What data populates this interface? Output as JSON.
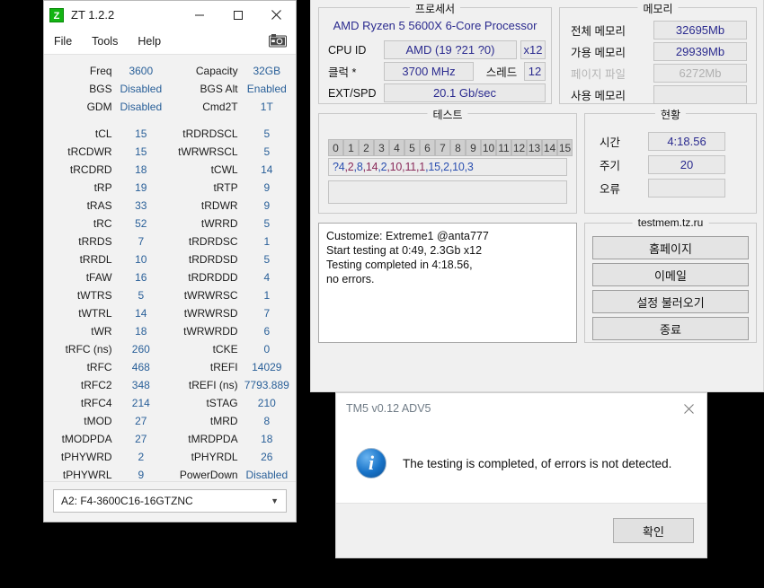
{
  "zt": {
    "title": "ZT 1.2.2",
    "logo_text": "Z",
    "menu": [
      "File",
      "Tools",
      "Help"
    ],
    "camera_icon": "camera-icon",
    "window_buttons": {
      "minimize": "minimize-icon",
      "maximize": "maximize-icon",
      "close": "close-icon"
    },
    "summary_rows": [
      {
        "l1": "Freq",
        "v1": "3600",
        "l2": "Capacity",
        "v2": "32GB"
      },
      {
        "l1": "BGS",
        "v1": "Disabled",
        "l2": "BGS Alt",
        "v2": "Enabled"
      },
      {
        "l1": "GDM",
        "v1": "Disabled",
        "l2": "Cmd2T",
        "v2": "1T"
      }
    ],
    "timing_rows": [
      {
        "l1": "tCL",
        "v1": "15",
        "l2": "tRDRDSCL",
        "v2": "5"
      },
      {
        "l1": "tRCDWR",
        "v1": "15",
        "l2": "tWRWRSCL",
        "v2": "5"
      },
      {
        "l1": "tRCDRD",
        "v1": "18",
        "l2": "tCWL",
        "v2": "14"
      },
      {
        "l1": "tRP",
        "v1": "19",
        "l2": "tRTP",
        "v2": "9"
      },
      {
        "l1": "tRAS",
        "v1": "33",
        "l2": "tRDWR",
        "v2": "9"
      },
      {
        "l1": "tRC",
        "v1": "52",
        "l2": "tWRRD",
        "v2": "5"
      },
      {
        "l1": "tRRDS",
        "v1": "7",
        "l2": "tRDRDSC",
        "v2": "1"
      },
      {
        "l1": "tRRDL",
        "v1": "10",
        "l2": "tRDRDSD",
        "v2": "5"
      },
      {
        "l1": "tFAW",
        "v1": "16",
        "l2": "tRDRDDD",
        "v2": "4"
      },
      {
        "l1": "tWTRS",
        "v1": "5",
        "l2": "tWRWRSC",
        "v2": "1"
      },
      {
        "l1": "tWTRL",
        "v1": "14",
        "l2": "tWRWRSD",
        "v2": "7"
      },
      {
        "l1": "tWR",
        "v1": "18",
        "l2": "tWRWRDD",
        "v2": "6"
      },
      {
        "l1": "tRFC (ns)",
        "v1": "260",
        "l2": "tCKE",
        "v2": "0"
      },
      {
        "l1": "tRFC",
        "v1": "468",
        "l2": "tREFI",
        "v2": "14029"
      },
      {
        "l1": "tRFC2",
        "v1": "348",
        "l2": "tREFI (ns)",
        "v2": "7793.889"
      },
      {
        "l1": "tRFC4",
        "v1": "214",
        "l2": "tSTAG",
        "v2": "210"
      },
      {
        "l1": "tMOD",
        "v1": "27",
        "l2": "tMRD",
        "v2": "8"
      },
      {
        "l1": "tMODPDA",
        "v1": "27",
        "l2": "tMRDPDA",
        "v2": "18"
      },
      {
        "l1": "tPHYWRD",
        "v1": "2",
        "l2": "tPHYRDL",
        "v2": "26"
      },
      {
        "l1": "tPHYWRL",
        "v1": "9",
        "l2": "PowerDown",
        "v2": "Disabled"
      }
    ],
    "module_select": {
      "value": "A2: F4-3600C16-16GTZNC",
      "arrow": "chevron-down-icon"
    }
  },
  "tm5": {
    "processor": {
      "legend": "프로세서",
      "name": "AMD Ryzen 5 5600X 6-Core Processor",
      "cpuid_label": "CPU ID",
      "cpuid_value": "AMD  (19 ?21 ?0)",
      "cores_value": "x12",
      "clock_label": "클럭 *",
      "clock_value": "3700 MHz",
      "threads_label": "스레드",
      "threads_value": "12",
      "extspd_label": "EXT/SPD",
      "extspd_value": "20.1 Gb/sec"
    },
    "memory": {
      "legend": "메모리",
      "rows": [
        {
          "label": "전체 메모리",
          "value": "32695Mb",
          "dim": false
        },
        {
          "label": "가용 메모리",
          "value": "29939Mb",
          "dim": false
        },
        {
          "label": "페이지 파일",
          "value": "6272Mb",
          "dim": true
        },
        {
          "label": "사용 메모리",
          "value": "",
          "dim": false
        }
      ]
    },
    "test": {
      "legend": "테스트",
      "cells": [
        "0",
        "1",
        "2",
        "3",
        "4",
        "5",
        "6",
        "7",
        "8",
        "9",
        "10",
        "11",
        "12",
        "13",
        "14",
        "15"
      ],
      "sequence": "?4,2,8,14,2,10,11,1,15,2,10,3",
      "blank": ""
    },
    "status": {
      "legend": "현황",
      "rows": [
        {
          "label": "시간",
          "value": "4:18.56"
        },
        {
          "label": "주기",
          "value": "20"
        },
        {
          "label": "오류",
          "value": ""
        }
      ]
    },
    "log": {
      "lines": [
        "Customize: Extreme1 @anta777",
        "Start testing at 0:49, 2.3Gb x12",
        "Testing completed in 4:18.56,",
        "no errors."
      ]
    },
    "links": {
      "legend": "testmem.tz.ru",
      "buttons": [
        "홈페이지",
        "이메일",
        "설정 불러오기",
        "종료"
      ]
    }
  },
  "dialog": {
    "title": "TM5 v0.12 ADV5",
    "close_icon": "close-icon",
    "info_icon": "info-icon",
    "info_glyph": "i",
    "message": "The testing is completed, of errors is not detected.",
    "ok_label": "확인"
  },
  "colors": {
    "accent_blue": "#2a6099",
    "value_purple": "#2b2b8f",
    "logo_green": "#13b413"
  }
}
